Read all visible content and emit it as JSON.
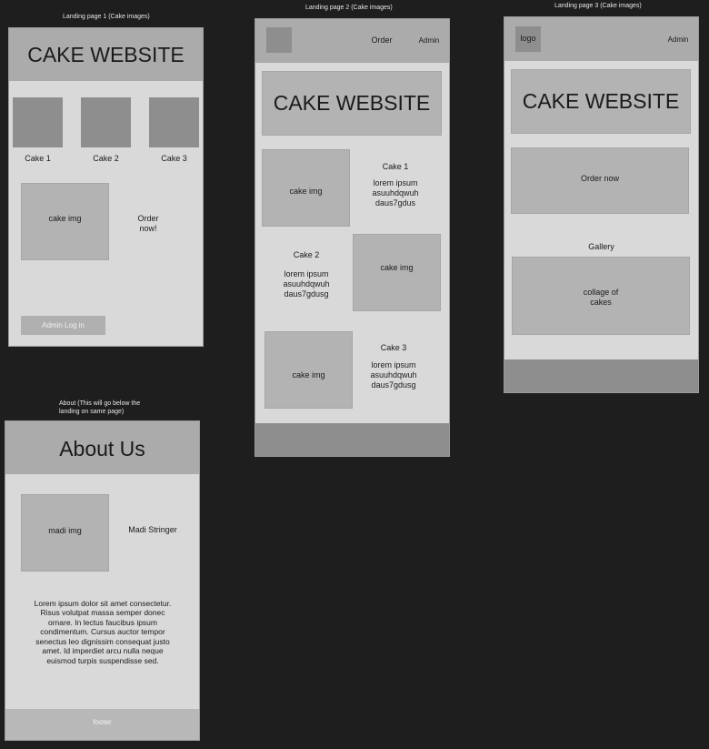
{
  "frames": {
    "landing1": {
      "label": "Landing page 1 (Cake images)",
      "title": "CAKE WEBSITE",
      "cakes": [
        "Cake 1",
        "Cake 2",
        "Cake 3"
      ],
      "cake_img": "cake img",
      "order_now": "Order\nnow!",
      "admin_login": "Admin Log in"
    },
    "landing2": {
      "label": "Landing page 2 (Cake images)",
      "nav_order": "Order",
      "nav_admin": "Admin",
      "title": "CAKE WEBSITE",
      "items": [
        {
          "img": "cake img",
          "name": "Cake 1",
          "desc": "lorem ipsum\nasuuhdqwuh\ndaus7gdus"
        },
        {
          "img": "cake img",
          "name": "Cake 2",
          "desc": "lorem ipsum\nasuuhdqwuh\ndaus7gdusg"
        },
        {
          "img": "cake img",
          "name": "Cake 3",
          "desc": "lorem ipsum\nasuuhdqwuh\ndaus7gdusg"
        }
      ]
    },
    "landing3": {
      "label": "Landing page 3 (Cake images)",
      "logo": "logo",
      "nav_admin": "Admin",
      "title": "CAKE WEBSITE",
      "order_now": "Order now",
      "gallery": "Gallery",
      "collage": "collage of\ncakes"
    },
    "about": {
      "label": "About (This will go below the\nlanding on same page)",
      "title": "About Us",
      "img": "madi img",
      "name": "Madi Stringer",
      "body": "Lorem ipsum dolor sit amet consectetur.\nRisus volutpat massa semper donec\nornare. In lectus faucibus ipsum\ncondimentum. Cursus auctor tempor\nsenectus leo dignissim consequat justo\namet. Id imperdiet arcu nulla neque\neuismod turpis suspendisse sed.",
      "footer": "footer"
    }
  }
}
